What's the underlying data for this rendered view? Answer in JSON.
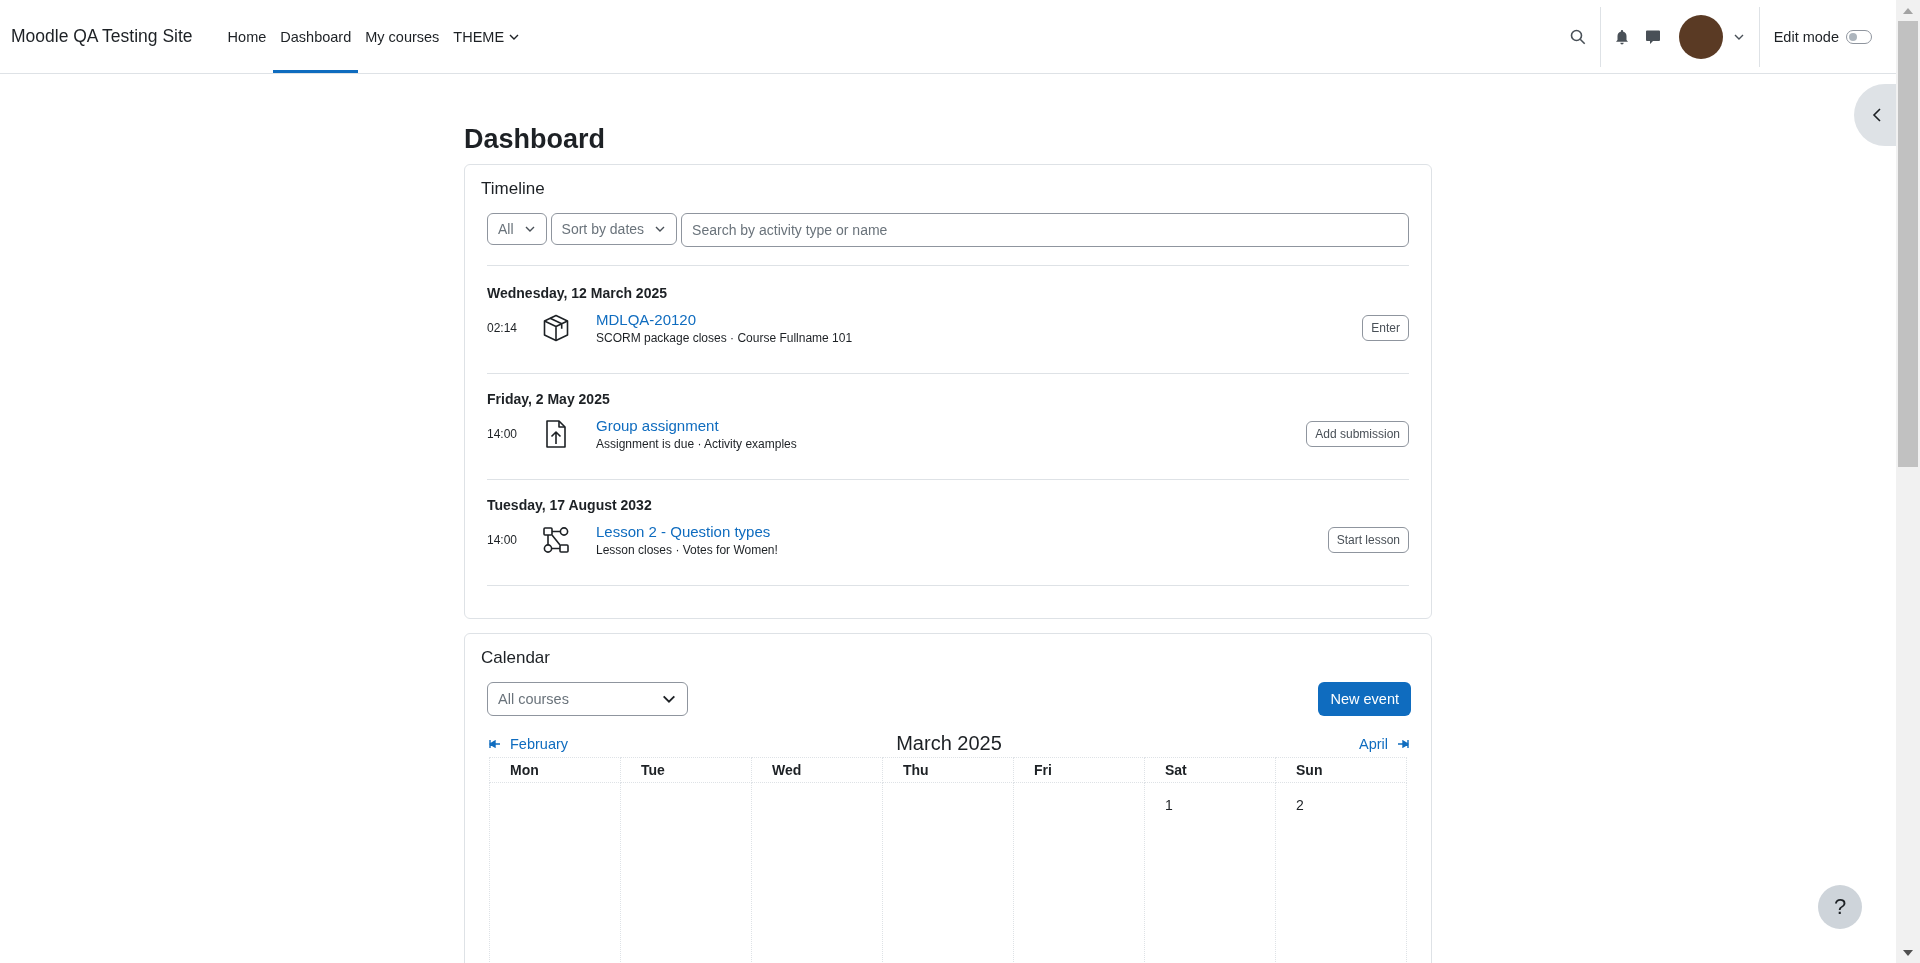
{
  "site_name": "Moodle QA Testing Site",
  "nav": [
    {
      "label": "Home",
      "selected": false,
      "kind": "link"
    },
    {
      "label": "Dashboard",
      "selected": true,
      "kind": "link"
    },
    {
      "label": "My courses",
      "selected": false,
      "kind": "link"
    },
    {
      "label": "THEME",
      "selected": false,
      "kind": "dropdown"
    }
  ],
  "edit_mode": {
    "label": "Edit mode",
    "on": false
  },
  "page_title": "Dashboard",
  "timeline": {
    "title": "Timeline",
    "filter": "All",
    "sort": "Sort by dates",
    "search": {
      "placeholder": "Search by activity type or name"
    },
    "groups": [
      {
        "date": "Wednesday, 12 March 2025",
        "events": [
          {
            "time": "02:14",
            "kind": "scorm",
            "name": "MDLQA-20120",
            "detail": "SCORM package closes · Course Fullname 101",
            "action": "Enter"
          }
        ]
      },
      {
        "date": "Friday, 2 May 2025",
        "events": [
          {
            "time": "14:00",
            "kind": "assignment",
            "name": "Group assignment",
            "detail": "Assignment is due · Activity examples",
            "action": "Add submission"
          }
        ]
      },
      {
        "date": "Tuesday, 17 August 2032",
        "events": [
          {
            "time": "14:00",
            "kind": "lesson",
            "name": "Lesson 2 - Question types",
            "detail": "Lesson closes · Votes for Women!",
            "action": "Start lesson"
          }
        ]
      }
    ]
  },
  "calendar": {
    "title": "Calendar",
    "course_filter": "All courses",
    "new_event": "New event",
    "prev": "February",
    "month": "March 2025",
    "next": "April",
    "weekdays": [
      "Mon",
      "Tue",
      "Wed",
      "Thu",
      "Fri",
      "Sat",
      "Sun"
    ],
    "weeks": [
      [
        {
          "kind": "empty"
        },
        {
          "kind": "empty"
        },
        {
          "kind": "empty"
        },
        {
          "kind": "empty"
        },
        {
          "kind": "empty"
        },
        {
          "kind": "day",
          "label": "1"
        },
        {
          "kind": "day",
          "label": "2"
        }
      ]
    ]
  },
  "help": "?"
}
